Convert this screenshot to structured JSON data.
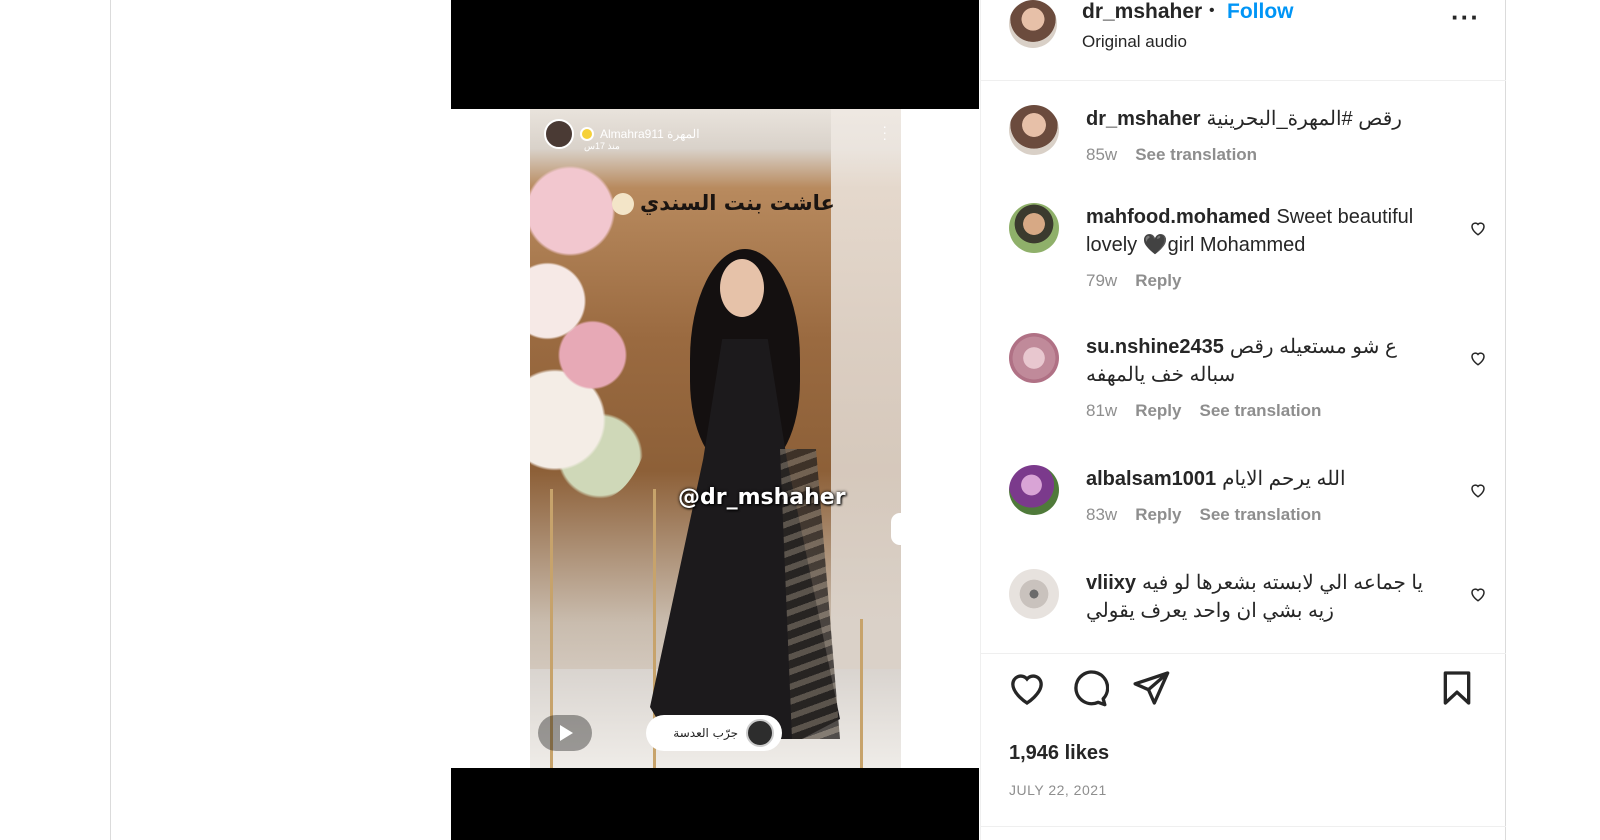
{
  "post": {
    "username": "dr_mshaher",
    "separator": "•",
    "follow_label": "Follow",
    "audio_label": "Original audio",
    "more_icon": "more-options-icon"
  },
  "media": {
    "story_username": "Almahra911 المهرة",
    "story_time": "منذ 17س",
    "overlay_caption": "عاشت بنت السندي",
    "mention": "@dr_mshaher",
    "lens_label": "جرّب العدسة"
  },
  "caption": {
    "username": "dr_mshaher",
    "text": "رقص #المهرة_البحرينية",
    "age": "85w",
    "translation_label": "See translation"
  },
  "comments": [
    {
      "username": "mahfood.mohamed",
      "text": "Sweet beautiful lovely 🖤girl Mohammed",
      "age": "79w",
      "reply_label": "Reply",
      "translation_label": ""
    },
    {
      "username": "su.nshine2435",
      "text": "ع شو مستعيله رقص سباله خف يالمهفه",
      "age": "81w",
      "reply_label": "Reply",
      "translation_label": "See translation"
    },
    {
      "username": "albalsam1001",
      "text": "الله يرحم الايام",
      "age": "83w",
      "reply_label": "Reply",
      "translation_label": "See translation"
    },
    {
      "username": "vliixy",
      "text": "يا جماعه الي لابسته بشعرها لو فيه زيه بشي ان واحد يعرف يقولي",
      "age": "",
      "reply_label": "",
      "translation_label": ""
    }
  ],
  "stats": {
    "likes": "1,946 likes",
    "date": "JULY 22, 2021"
  },
  "colors": {
    "link_blue": "#0095f6",
    "text": "#262626",
    "muted": "#8e8e8e",
    "border": "#dbdbdb"
  }
}
